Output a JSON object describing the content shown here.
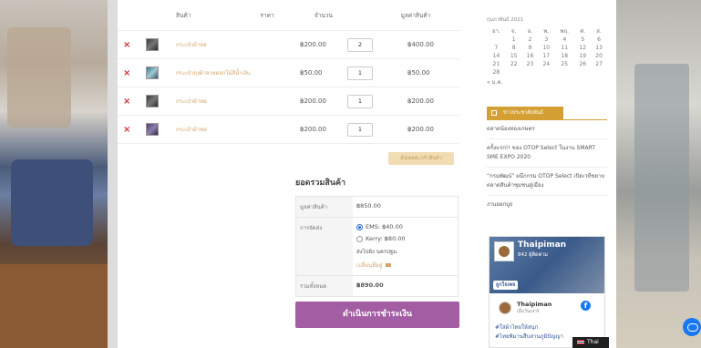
{
  "cart": {
    "headers": {
      "product": "สินค้า",
      "price": "ราคา",
      "qty": "จำนวน",
      "subtotal": "มูลค่าสินค้า"
    },
    "items": [
      {
        "name": "กระเป๋าผ้าทอ",
        "price": "฿200.00",
        "qty": "2",
        "subtotal": "฿400.00"
      },
      {
        "name": "กระเป๋าถุงผ้าลายดอกไม้สีน้ำเงิน",
        "price": "฿50.00",
        "qty": "1",
        "subtotal": "฿50.00"
      },
      {
        "name": "กระเป๋าผ้าทอ",
        "price": "฿200.00",
        "qty": "1",
        "subtotal": "฿200.00"
      },
      {
        "name": "กระเป๋าผ้าทอ",
        "price": "฿200.00",
        "qty": "1",
        "subtotal": "฿200.00"
      }
    ],
    "update_label": "อัปเดตตะกร้าสินค้า",
    "remove_glyph": "×"
  },
  "totals": {
    "title": "ยอดรวมสินค้า",
    "subtotal_label": "มูลค่าสินค้า",
    "subtotal_value": "฿850.00",
    "shipping_label": "การจัดส่ง",
    "options": [
      "EMS: ฿40.00",
      "Kerry: ฿80.00"
    ],
    "ship_to": "ส่งไปยัง นครปฐม.",
    "change_address": "เปลี่ยนที่อยู่",
    "total_label": "รวมทั้งหมด",
    "total_value": "฿890.00",
    "checkout_label": "ดำเนินการชำระเงิน"
  },
  "sidebar": {
    "calendar_caption": "กุมภาพันธ์ 2021",
    "weekdays": [
      "อา.",
      "จ.",
      "อ.",
      "พ.",
      "พฤ.",
      "ศ.",
      "ส."
    ],
    "weeks": [
      [
        "",
        "1",
        "2",
        "3",
        "4",
        "5",
        "6"
      ],
      [
        "7",
        "8",
        "9",
        "10",
        "11",
        "12",
        "13"
      ],
      [
        "14",
        "15",
        "16",
        "17",
        "18",
        "19",
        "20"
      ],
      [
        "21",
        "22",
        "23",
        "24",
        "25",
        "26",
        "27"
      ],
      [
        "28",
        "",
        "",
        "",
        "",
        "",
        ""
      ]
    ],
    "prev_month": "« ม.ค.",
    "news_title": "ข่าวประชาสัมพันธ์",
    "news": [
      "ตลาดน้องทองเกษตร",
      "ครั้งแรก!! ของ OTOP Select ในงาน SMART SME EXPO 2020",
      "“กรมพัฒน์” ผนึกกรม OTOP Select เปิดเวทีขยายตลาดสินค้าชุมชนสู่เมือง",
      "งานออกบูธ"
    ]
  },
  "facebook": {
    "page_name": "Thaipiman",
    "likes": "842 ผู้ติดตาม",
    "follow_label": "ถูกใจเพจ",
    "post_name": "Thaipiman",
    "post_sub": "เมื่อวันเสาร์",
    "tag1": "#ใส่ผ้าไทยให้สนุก",
    "tag2": "#ไทยพิมานสืบสานภูมิปัญญา"
  },
  "language": "Thai"
}
